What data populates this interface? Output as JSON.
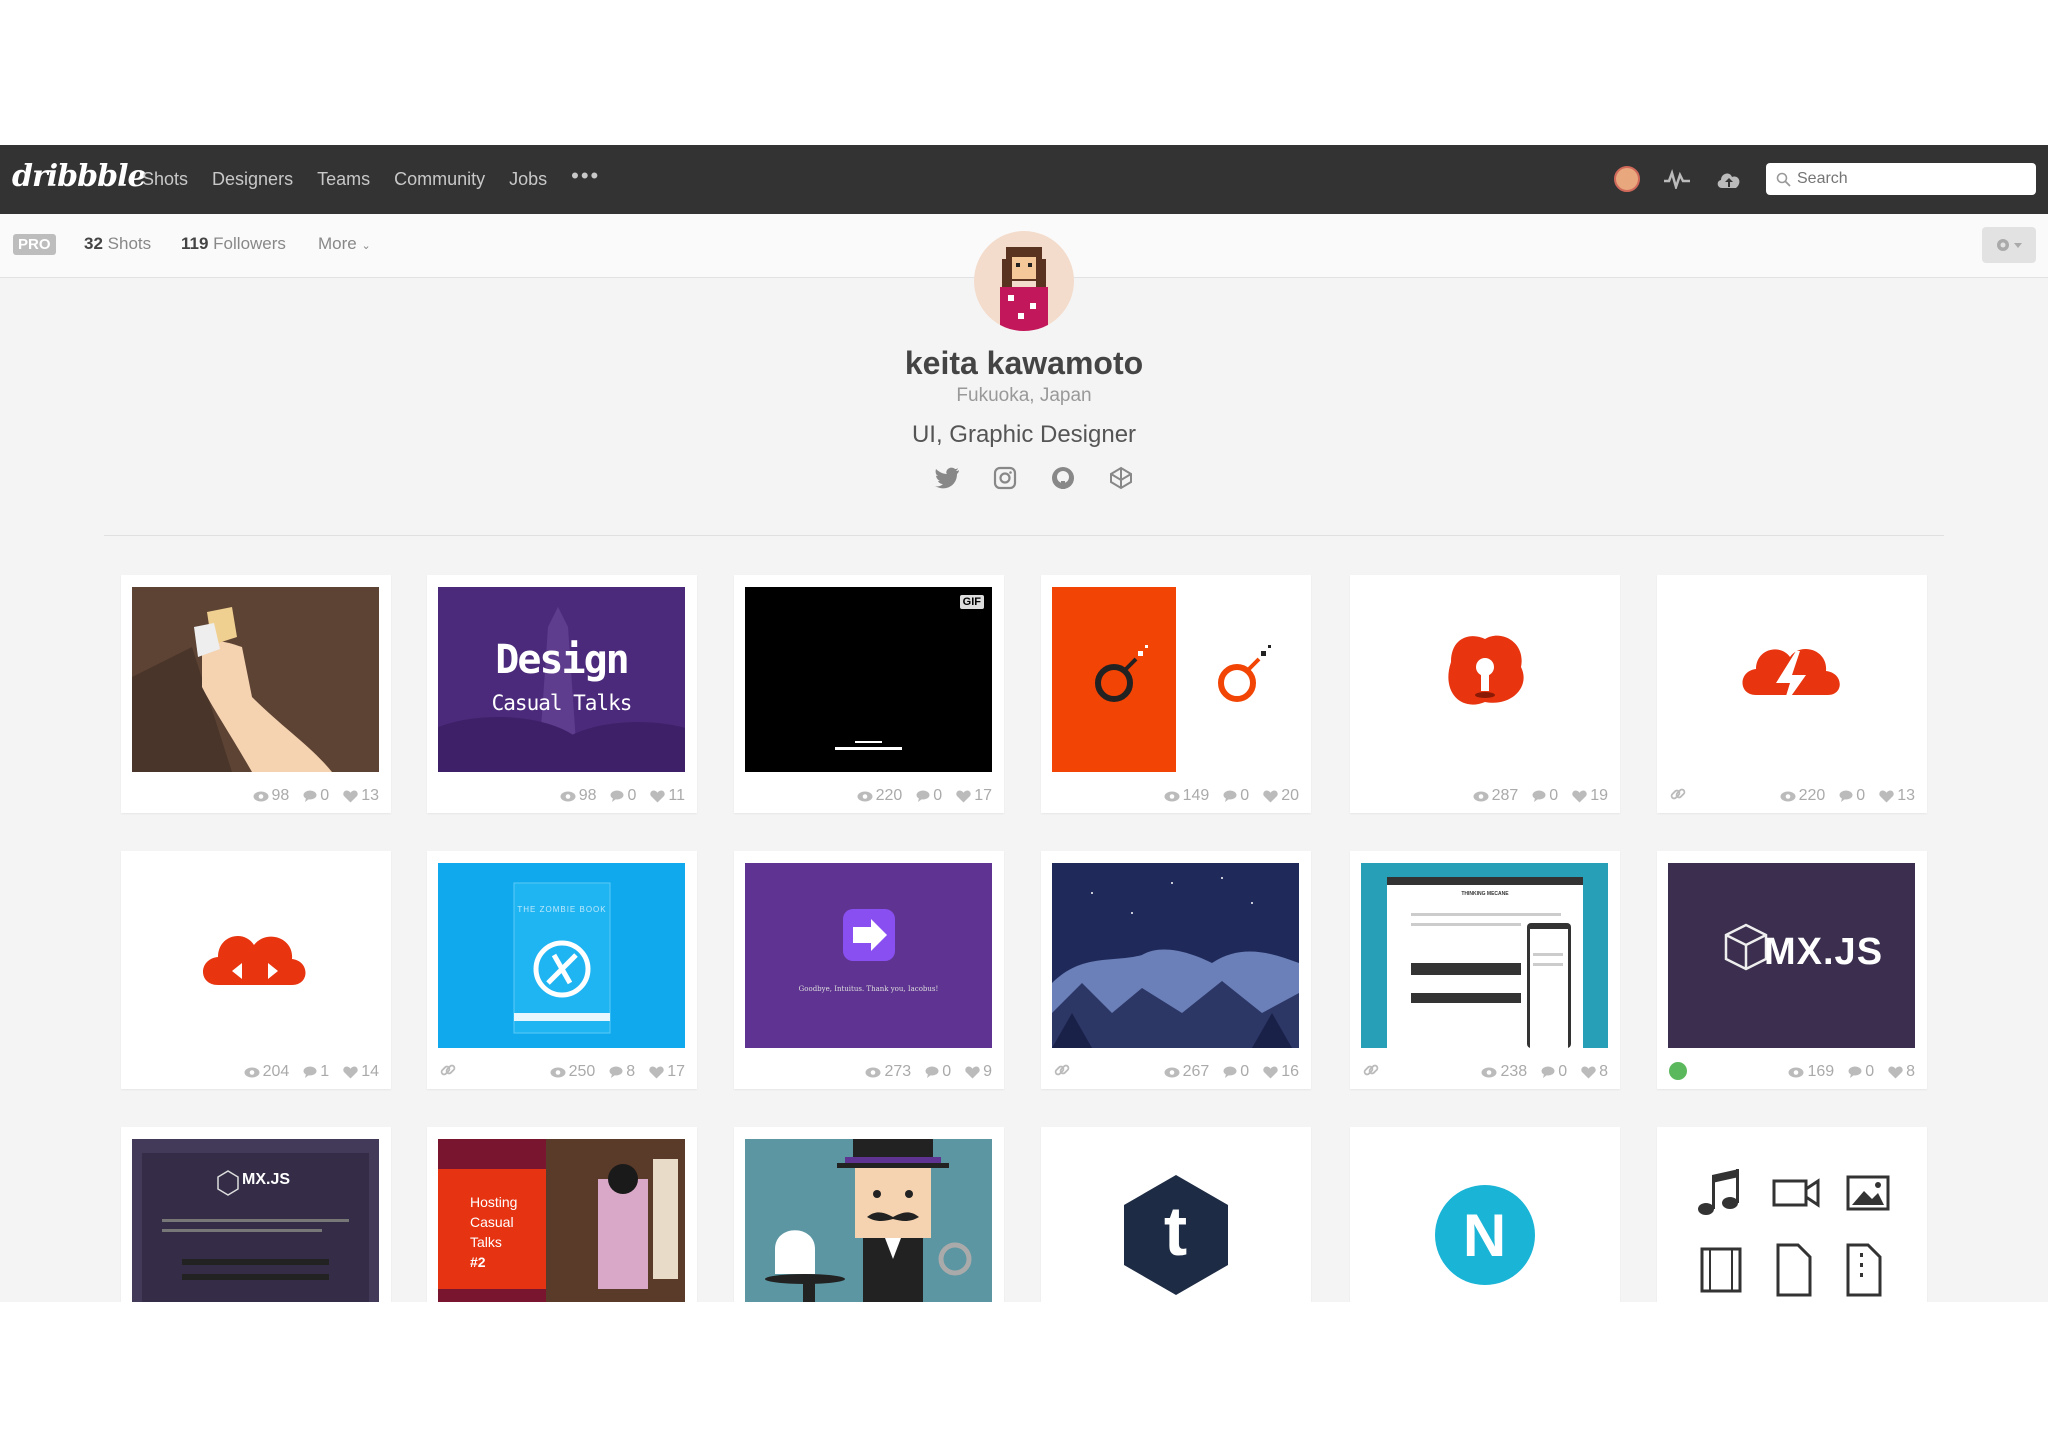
{
  "nav": {
    "logo": "dribbble",
    "links": [
      "Shots",
      "Designers",
      "Teams",
      "Community",
      "Jobs"
    ],
    "more": "•••",
    "search_placeholder": "Search"
  },
  "subnav": {
    "pro": "PRO",
    "shots_count": "32",
    "shots_label": "Shots",
    "followers_count": "119",
    "followers_label": "Followers",
    "more_label": "More"
  },
  "profile": {
    "name": "keita kawamoto",
    "location": "Fukuoka, Japan",
    "bio": "UI, Graphic Designer"
  },
  "shots": [
    {
      "views": "98",
      "comments": "0",
      "likes": "13"
    },
    {
      "views": "98",
      "comments": "0",
      "likes": "11",
      "title": "Design",
      "subtitle": "Casual Talks"
    },
    {
      "views": "220",
      "comments": "0",
      "likes": "17",
      "badge": "GIF"
    },
    {
      "views": "149",
      "comments": "0",
      "likes": "20"
    },
    {
      "views": "287",
      "comments": "0",
      "likes": "19"
    },
    {
      "views": "220",
      "comments": "0",
      "likes": "13"
    },
    {
      "views": "204",
      "comments": "1",
      "likes": "14"
    },
    {
      "views": "250",
      "comments": "8",
      "likes": "17",
      "title": "THE ZOMBIE BOOK"
    },
    {
      "views": "273",
      "comments": "0",
      "likes": "9",
      "caption": "Goodbye, Intuitus. Thank you, Iacobus!"
    },
    {
      "views": "267",
      "comments": "0",
      "likes": "16"
    },
    {
      "views": "238",
      "comments": "0",
      "likes": "8",
      "caption": "THINKING MECANE"
    },
    {
      "views": "169",
      "comments": "0",
      "likes": "8",
      "title": "MX.JS"
    },
    {
      "title": "MX.JS"
    },
    {
      "title": "Hosting",
      "subtitle": "Casual",
      "extra": "Talks",
      "num": "#2"
    },
    {},
    {
      "glyph": "t"
    },
    {
      "glyph": "N"
    },
    {}
  ]
}
